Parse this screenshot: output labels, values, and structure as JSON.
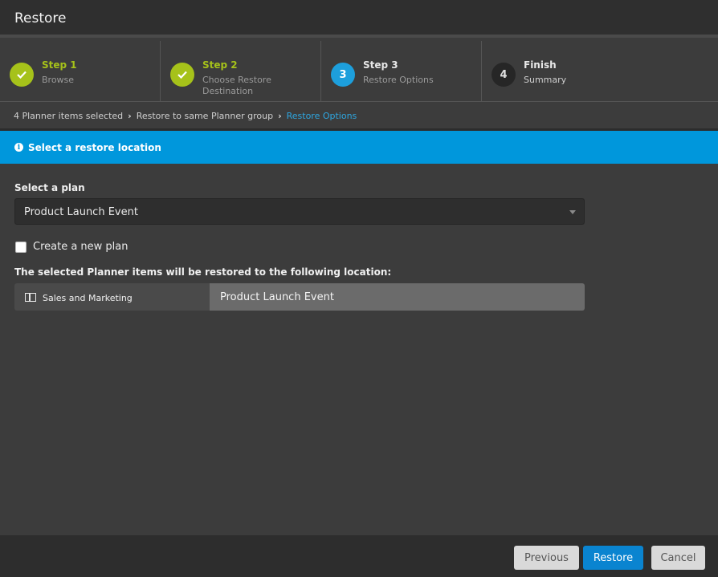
{
  "window": {
    "title": "Restore"
  },
  "steps": [
    {
      "number": "",
      "title": "Step 1",
      "subtitle": "Browse",
      "state": "done"
    },
    {
      "number": "",
      "title": "Step 2",
      "subtitle": "Choose Restore Destination",
      "state": "done"
    },
    {
      "number": "3",
      "title": "Step 3",
      "subtitle": "Restore Options",
      "state": "active"
    },
    {
      "number": "4",
      "title": "Finish",
      "subtitle": "Summary",
      "state": "pending"
    }
  ],
  "breadcrumb": {
    "items": [
      "4 Planner items selected",
      "Restore to same Planner group"
    ],
    "current": "Restore Options"
  },
  "info": {
    "text": "Select a restore location",
    "icon": "info-icon"
  },
  "form": {
    "plan_label": "Select a plan",
    "plan_value": "Product Launch Event",
    "new_plan_label": "Create a new plan",
    "new_plan_checked": false,
    "destination_label": "The selected Planner items will be restored to the following location:",
    "destination_group": "Sales and Marketing",
    "destination_plan": "Product Launch Event"
  },
  "footer": {
    "previous_label": "Previous",
    "restore_label": "Restore",
    "cancel_label": "Cancel"
  },
  "colors": {
    "accent_green": "#a6c21a",
    "accent_blue": "#1d9fdc",
    "info_bar": "#0097dc",
    "primary_button": "#0a84d0"
  }
}
